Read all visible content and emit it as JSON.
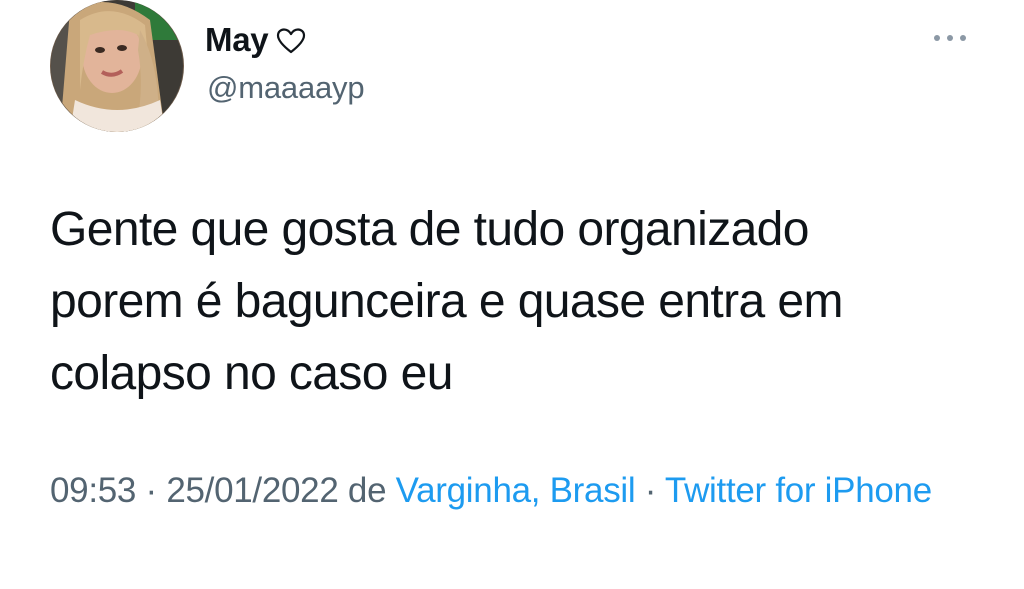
{
  "user": {
    "display_name": "May",
    "name_icon": "heart-outline-icon",
    "handle": "@maaaayp",
    "avatar": "avatar-photo"
  },
  "menu": {
    "icon": "more-horizontal-icon"
  },
  "tweet": {
    "text": "Gente que gosta de tudo organizado\nporem é bagunceira e quase entra em\ncolapso no caso eu"
  },
  "meta": {
    "time": "09:53",
    "separator_1": " · ",
    "date": "25/01/2022",
    "location_prefix": " de ",
    "location": "Varginha, Brasil",
    "separator_2": " · ",
    "source": "Twitter for iPhone"
  },
  "colors": {
    "text_primary": "#0f1419",
    "text_secondary": "#536471",
    "link": "#1d9bf0"
  }
}
